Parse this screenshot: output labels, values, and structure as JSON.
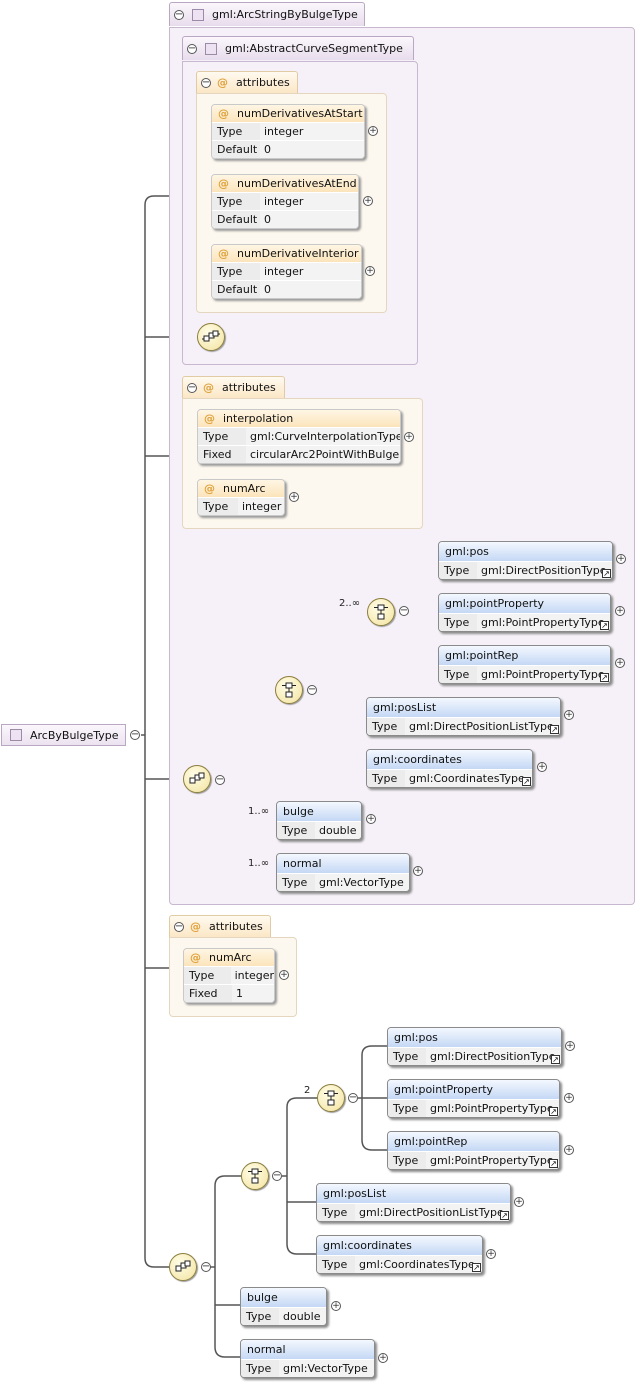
{
  "root": {
    "name": "ArcByBulgeType"
  },
  "base_type": {
    "name": "gml:ArcStringByBulgeType",
    "abstract_type": {
      "name": "gml:AbstractCurveSegmentType",
      "attributes_label": "attributes",
      "attributes": [
        {
          "name": "numDerivativesAtStart",
          "rows": [
            {
              "k": "Type",
              "v": "integer"
            },
            {
              "k": "Default",
              "v": "0"
            }
          ]
        },
        {
          "name": "numDerivativesAtEnd",
          "rows": [
            {
              "k": "Type",
              "v": "integer"
            },
            {
              "k": "Default",
              "v": "0"
            }
          ]
        },
        {
          "name": "numDerivativeInterior",
          "rows": [
            {
              "k": "Type",
              "v": "integer"
            },
            {
              "k": "Default",
              "v": "0"
            }
          ]
        }
      ]
    },
    "attributes_label": "attributes",
    "attributes": [
      {
        "name": "interpolation",
        "rows": [
          {
            "k": "Type",
            "v": "gml:CurveInterpolationType"
          },
          {
            "k": "Fixed",
            "v": "circularArc2PointWithBulge"
          }
        ]
      },
      {
        "name": "numArc",
        "rows": [
          {
            "k": "Type",
            "v": "integer"
          }
        ]
      }
    ],
    "choice_occurrence": "2..∞",
    "elements": [
      {
        "name": "gml:pos",
        "type": "gml:DirectPositionType"
      },
      {
        "name": "gml:pointProperty",
        "type": "gml:PointPropertyType"
      },
      {
        "name": "gml:pointRep",
        "type": "gml:PointPropertyType"
      },
      {
        "name": "gml:posList",
        "type": "gml:DirectPositionListType"
      },
      {
        "name": "gml:coordinates",
        "type": "gml:CoordinatesType"
      },
      {
        "name": "bulge",
        "type": "double",
        "occurrence": "1..∞"
      },
      {
        "name": "normal",
        "type": "gml:VectorType",
        "occurrence": "1..∞"
      }
    ]
  },
  "own": {
    "attributes_label": "attributes",
    "attribute": {
      "name": "numArc",
      "rows": [
        {
          "k": "Type",
          "v": "integer"
        },
        {
          "k": "Fixed",
          "v": "1"
        }
      ]
    },
    "choice_occurrence": "2",
    "elements": [
      {
        "name": "gml:pos",
        "type": "gml:DirectPositionType"
      },
      {
        "name": "gml:pointProperty",
        "type": "gml:PointPropertyType"
      },
      {
        "name": "gml:pointRep",
        "type": "gml:PointPropertyType"
      },
      {
        "name": "gml:posList",
        "type": "gml:DirectPositionListType"
      },
      {
        "name": "gml:coordinates",
        "type": "gml:CoordinatesType"
      },
      {
        "name": "bulge",
        "type": "double"
      },
      {
        "name": "normal",
        "type": "gml:VectorType"
      }
    ]
  },
  "type_label": "Type"
}
